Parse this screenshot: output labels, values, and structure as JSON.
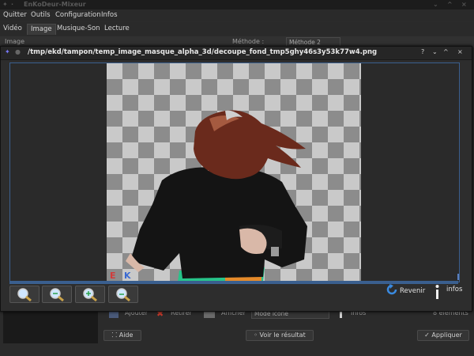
{
  "main_window": {
    "title": "EnKoDeur-Mixeur",
    "menu": [
      "Quitter",
      "Outils",
      "Configuration",
      "Infos"
    ],
    "tabs": [
      "Vidéo",
      "Image",
      "Musique-Son",
      "Lecture"
    ],
    "active_tab": "Image",
    "subheader": {
      "left": "Image",
      "methode_label": "Méthode :",
      "methode_value": "Méthode 2"
    },
    "lower_toolbar": {
      "ajouter": "Ajouter",
      "retirer": "Retirer",
      "afficher": "Afficher",
      "mode_value": "Mode icone",
      "infos": "Infos",
      "count": "8 éléments"
    },
    "bottom_buttons": {
      "aide": "Aide",
      "voir": "Voir le résultat",
      "appliquer": "Appliquer"
    }
  },
  "dialog": {
    "title": "/tmp/ekd/tampon/temp_image_masque_alpha_3d/decoupe_fond_tmp5ghy46s3y53k77w4.png",
    "controls": [
      "?",
      "⌄",
      "^",
      "×"
    ],
    "watermark": {
      "e": "E",
      "k": "K"
    },
    "revenir_label": "Revenir",
    "infos_label": "infos"
  },
  "colors": {
    "accent": "#3a5f8f",
    "bg": "#2d2d2d",
    "titlebar": "#262626",
    "hair": "#6a2a1c",
    "shirt": "#141414"
  }
}
